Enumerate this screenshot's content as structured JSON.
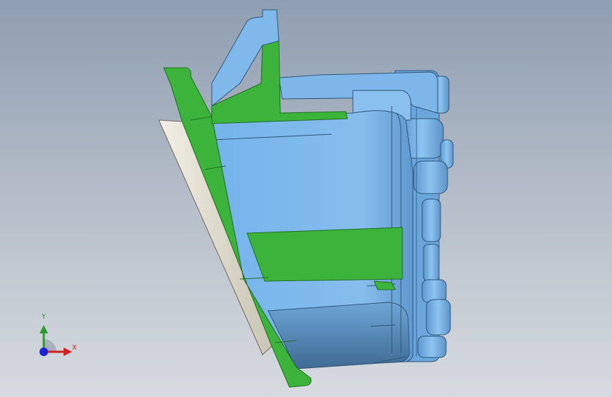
{
  "viewport": {
    "background_top": "#8e9db0",
    "background_bottom": "#d7dbe0"
  },
  "model": {
    "body_color": "#7fb8ea",
    "body_shade_color": "#4f7fa8",
    "section_cut_color": "#3cb43c",
    "gasket_color": "#e6e2d6"
  },
  "triad": {
    "x_label": "X",
    "y_label": "Y",
    "x_color": "#d02020",
    "y_color": "#2d9a2d",
    "z_color": "#1a22d8"
  }
}
